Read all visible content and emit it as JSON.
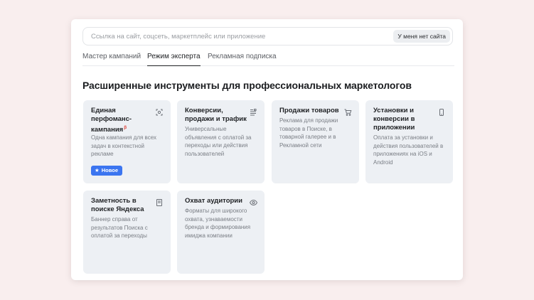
{
  "search": {
    "placeholder": "Ссылка на сайт, соцсеть, маркетплейс или приложение",
    "no_site_label": "У меня нет сайта"
  },
  "tabs": [
    {
      "label": "Мастер кампаний",
      "active": false
    },
    {
      "label": "Режим эксперта",
      "active": true
    },
    {
      "label": "Рекламная подписка",
      "active": false
    }
  ],
  "heading": "Расширенные инструменты для профессиональных маркетологов",
  "cards": [
    {
      "title": "Единая перфоманс-кампания",
      "beta": "β",
      "description": "Одна кампания для всех задач в контекстной рекламе",
      "icon": "target-scan-icon",
      "badge": "Новое"
    },
    {
      "title": "Конверсии, продажи и трафик",
      "description": "Универсальные объявления с оплатой за переходы или действия пользователей",
      "icon": "list-lines-icon"
    },
    {
      "title": "Продажи товаров",
      "description": "Реклама для продажи товаров в Поиске, в товарной галерее и в Рекламной сети",
      "icon": "shopping-cart-icon"
    },
    {
      "title": "Установки и конверсии в приложении",
      "description": "Оплата за установки и действия пользователей в приложениях на iOS и Android",
      "icon": "smartphone-icon"
    },
    {
      "title": "Заметность в поиске Яндекса",
      "description": "Баннер справа от результатов Поиска с оплатой за переходы",
      "icon": "banner-icon"
    },
    {
      "title": "Охват аудитории",
      "description": "Форматы для широкого охвата, узнаваемости бренда и формирования имиджа компании",
      "icon": "eye-icon"
    }
  ],
  "colors": {
    "background": "#f9eeee",
    "card": "#edf0f4",
    "badge": "#3b75f0",
    "beta": "#e0473d"
  }
}
